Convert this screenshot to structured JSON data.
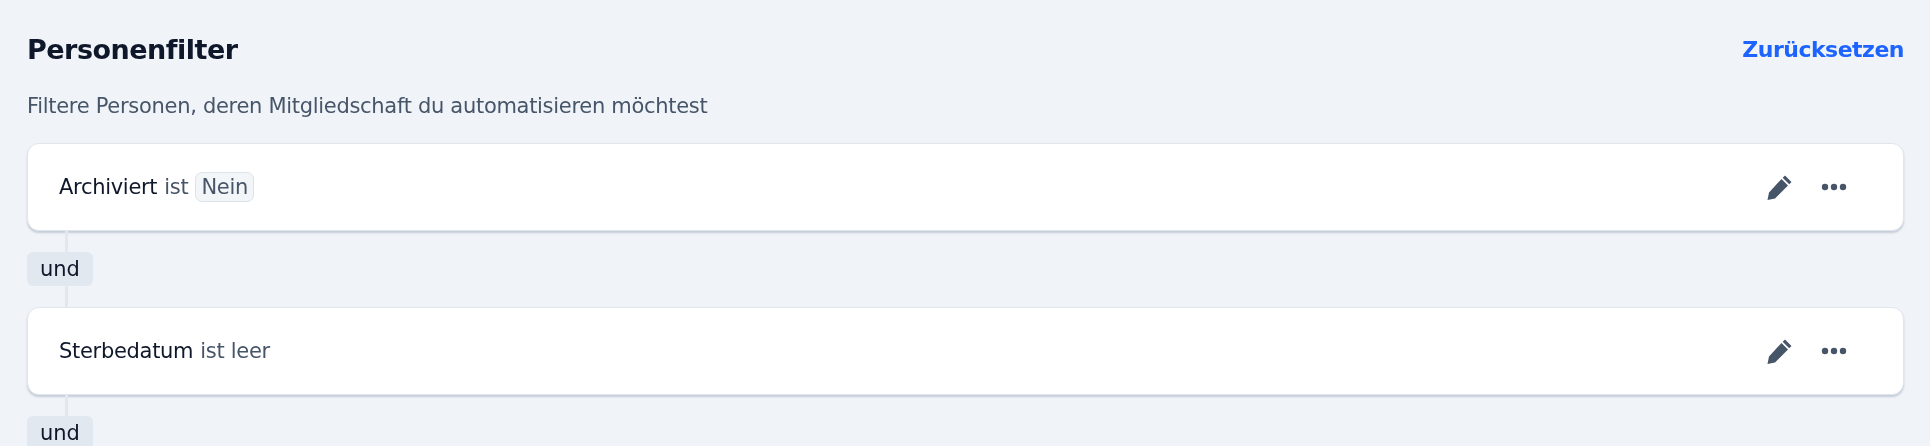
{
  "header": {
    "title": "Personenfilter",
    "reset_link": "Zurücksetzen",
    "subtitle": "Filtere Personen, deren Mitgliedschaft du automatisieren möchtest"
  },
  "filters": [
    {
      "field": "Archiviert",
      "operator": "ist",
      "value": "Nein",
      "connector": "und"
    },
    {
      "field": "Sterbedatum",
      "operator": "ist leer",
      "connector": "und"
    }
  ]
}
